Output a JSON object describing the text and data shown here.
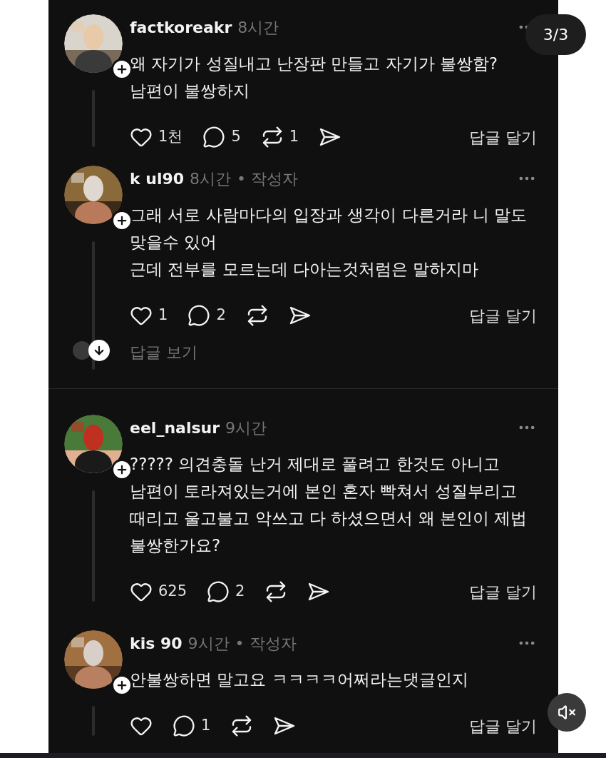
{
  "page_indicator": "3/3",
  "comments": [
    {
      "author": "factkoreakr",
      "time": "8시간",
      "lines": [
        "왜 자기가 성질내고 난장판 만들고 자기가 불쌍함?",
        "남편이 불쌍하지"
      ],
      "likes": "1천",
      "replies": "5",
      "reposts": "1",
      "reply_button": "답글 달기"
    },
    {
      "author": "k ul90",
      "time": "8시간",
      "author_tag": "• 작성자",
      "lines": [
        "그래 서로 사람마다의 입장과 생각이 다른거라 니 말도",
        "맞을수 있어",
        "근데 전부를 모르는데 다아는것처럼은 말하지마"
      ],
      "likes": "1",
      "replies": "2",
      "reply_button": "답글 달기",
      "view_replies": "답글 보기"
    },
    {
      "author": "eel_nalsur",
      "time": "9시간",
      "lines": [
        "????? 의견충돌 난거 제대로 풀려고 한것도 아니고",
        "남편이 토라져있는거에 본인 혼자 빡쳐서 성질부리고",
        "때리고 울고불고 악쓰고 다 하셨으면서 왜 본인이 제법",
        "불쌍한가요?"
      ],
      "likes": "625",
      "replies": "2",
      "reply_button": "답글 달기"
    },
    {
      "author": "kis 90",
      "time": "9시간",
      "author_tag": "• 작성자",
      "lines": [
        "안불쌍하면 말고요 ㅋㅋㅋㅋ어쩌라는댓글인지"
      ],
      "replies": "1",
      "reply_button": "답글 달기"
    }
  ]
}
